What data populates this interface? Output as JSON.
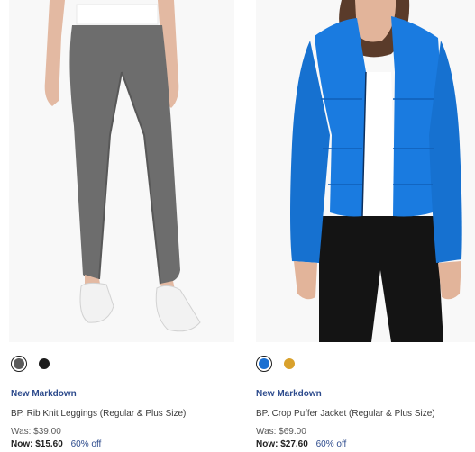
{
  "products": [
    {
      "badge": "New Markdown",
      "title": "BP. Rib Knit Leggings (Regular & Plus Size)",
      "was_price": "Was: $39.00",
      "now_price": "Now: $15.60",
      "discount": "60% off",
      "swatches": [
        {
          "color_name": "gray",
          "hex": "#5b5b5b",
          "selected": true
        },
        {
          "color_name": "black",
          "hex": "#1d1d1d",
          "selected": false
        }
      ]
    },
    {
      "badge": "New Markdown",
      "title": "BP. Crop Puffer Jacket (Regular & Plus Size)",
      "was_price": "Was: $69.00",
      "now_price": "Now: $27.60",
      "discount": "60% off",
      "swatches": [
        {
          "color_name": "blue",
          "hex": "#1a6fd1",
          "selected": true
        },
        {
          "color_name": "gold",
          "hex": "#d9a12c",
          "selected": false
        }
      ]
    }
  ],
  "colors": {
    "badge": "#2c4a8c",
    "text": "#393939",
    "photo_background": "#f7f7f7"
  }
}
